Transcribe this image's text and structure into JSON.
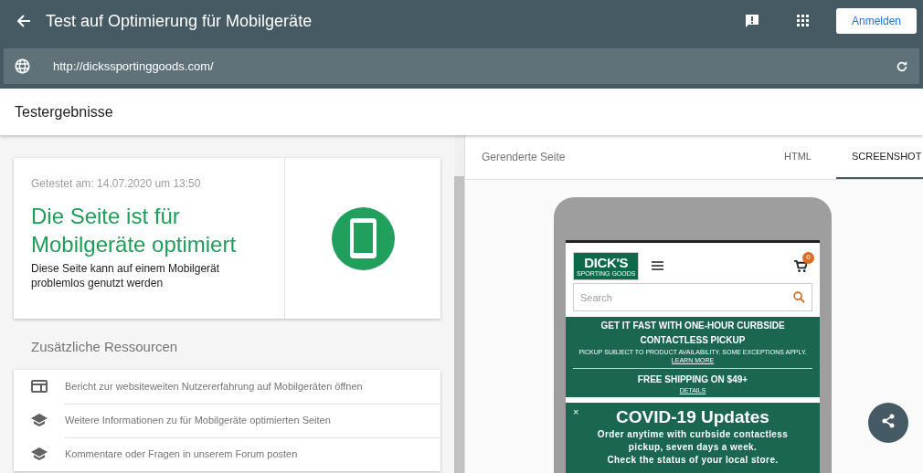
{
  "header": {
    "title": "Test auf Optimierung für Mobilgeräte",
    "sign_in": "Anmelden"
  },
  "url_bar": {
    "url": "http://dickssportinggoods.com/"
  },
  "section_title": "Testergebnisse",
  "result": {
    "tested": "Getestet am: 14.07.2020 um 13:50",
    "headline": "Die Seite ist für Mobilgeräte optimiert",
    "description": "Diese Seite kann auf einem Mobilgerät problemlos genutzt werden"
  },
  "resources": {
    "title": "Zusätzliche Ressourcen",
    "items": [
      {
        "kind": "report",
        "label": "Bericht zur websiteweiten Nutzererfahrung auf Mobilgeräten öffnen"
      },
      {
        "kind": "learn",
        "label": "Weitere Informationen zu für Mobilgeräte optimierten Seiten"
      },
      {
        "kind": "learn",
        "label": "Kommentare oder Fragen in unserem Forum posten"
      }
    ]
  },
  "preview": {
    "title": "Gerenderte Seite",
    "tabs": [
      {
        "label": "HTML",
        "selected": false
      },
      {
        "label": "SCREENSHOT",
        "selected": true
      }
    ]
  },
  "mobile_site": {
    "logo_main": "DICK'S",
    "logo_sub": "SPORTING GOODS",
    "cart_count": "0",
    "search_placeholder": "Search",
    "promo": {
      "headline": "GET IT FAST WITH ONE-HOUR CURBSIDE CONTACTLESS PICKUP",
      "note": "PICKUP SUBJECT TO PRODUCT AVAILABILITY. SOME EXCEPTIONS APPLY.",
      "link": "LEARN MORE"
    },
    "shipping": {
      "headline": "FREE SHIPPING ON $49+",
      "link": "DETAILS"
    },
    "covid": {
      "close": "×",
      "title": "COVID-19 Updates",
      "lines": [
        "Order anytime with curbside contactless",
        "pickup, seven days a week.",
        "Check the status of your local store."
      ]
    }
  }
}
